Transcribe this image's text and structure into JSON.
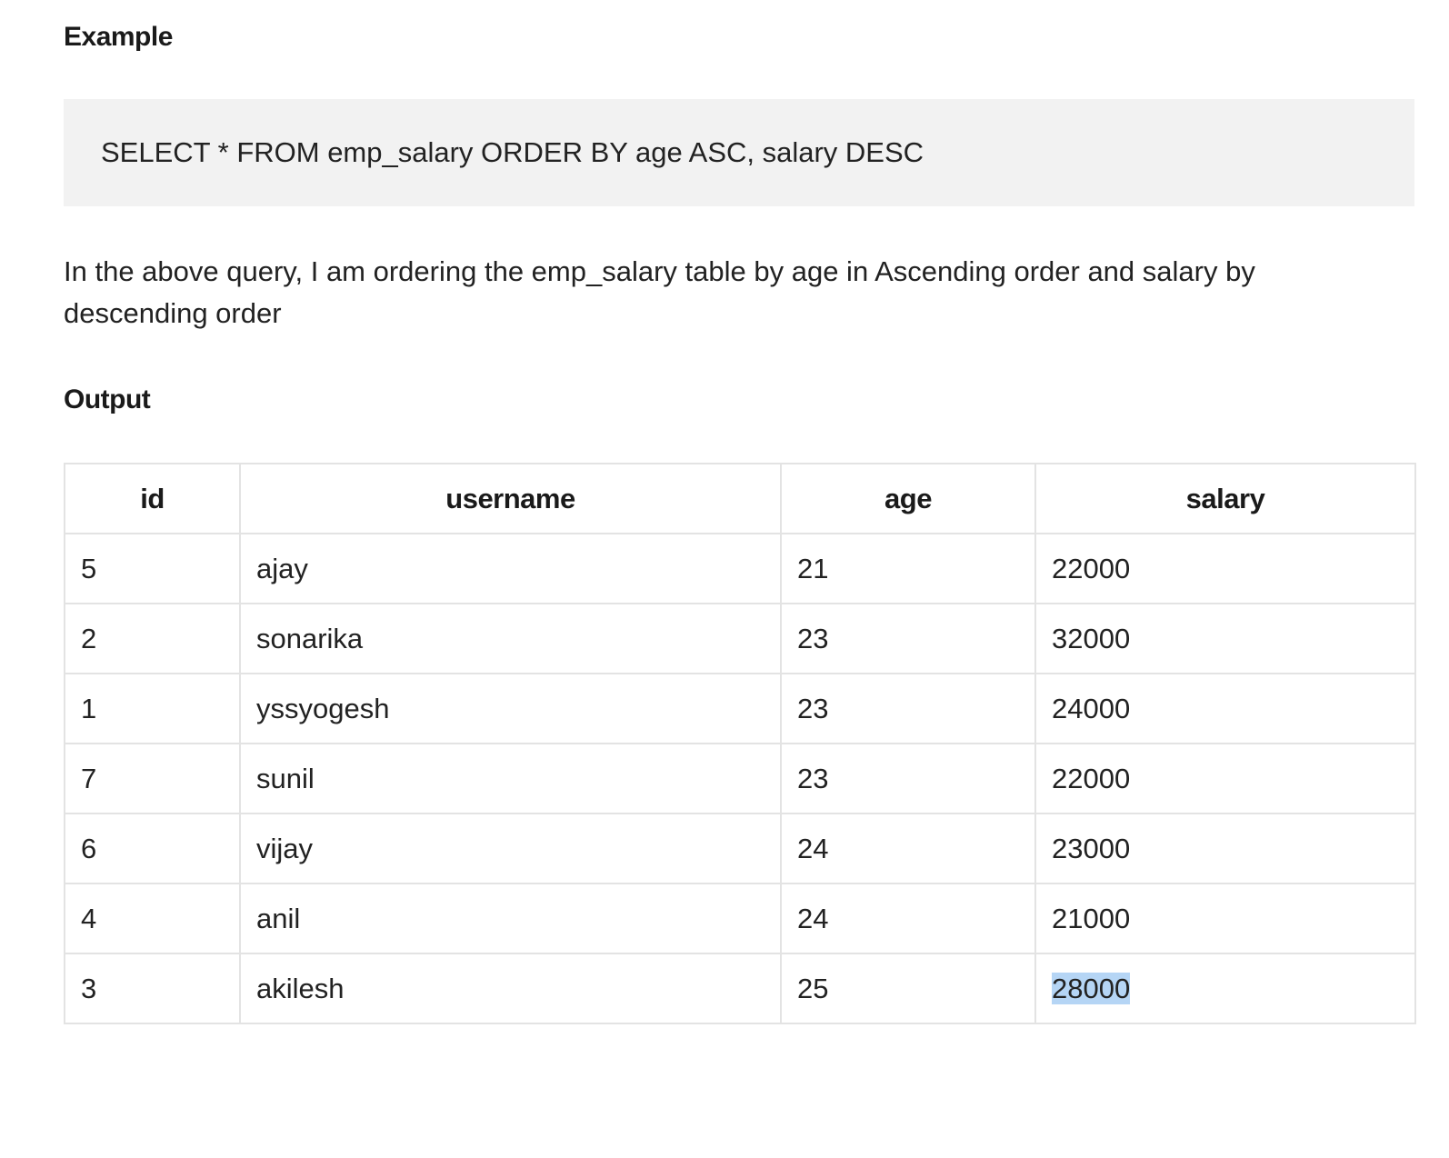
{
  "example_heading": "Example",
  "code": "SELECT * FROM emp_salary ORDER BY age ASC, salary DESC",
  "description": "In the above query, I am ordering the emp_salary table by age in Ascending order and salary by descending order",
  "output_heading": "Output",
  "table": {
    "headers": [
      "id",
      "username",
      "age",
      "salary"
    ],
    "rows": [
      [
        "5",
        "ajay",
        "21",
        "22000"
      ],
      [
        "2",
        "sonarika",
        "23",
        "32000"
      ],
      [
        "1",
        "yssyogesh",
        "23",
        "24000"
      ],
      [
        "7",
        "sunil",
        "23",
        "22000"
      ],
      [
        "6",
        "vijay",
        "24",
        "23000"
      ],
      [
        "4",
        "anil",
        "24",
        "21000"
      ],
      [
        "3",
        "akilesh",
        "25",
        "28000"
      ]
    ]
  },
  "colors": {
    "code_background": "#f2f2f2",
    "border": "#e3e3e3",
    "selection_highlight": "#b5d5f5"
  }
}
